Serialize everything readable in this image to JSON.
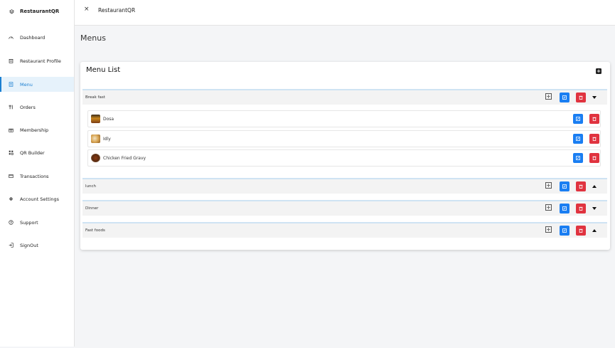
{
  "app": {
    "brand": "RestaurantQR",
    "top_title": "RestaurantQR",
    "close_glyph": "×"
  },
  "sidebar": {
    "items": [
      {
        "label": "Dashboard",
        "icon": "dashboard-icon"
      },
      {
        "label": "Restaurant Profile",
        "icon": "building-icon"
      },
      {
        "label": "Menu",
        "icon": "menu-icon",
        "active": true
      },
      {
        "label": "Orders",
        "icon": "utensils-icon"
      },
      {
        "label": "Membership",
        "icon": "membership-icon"
      },
      {
        "label": "QR Builder",
        "icon": "qr-icon"
      },
      {
        "label": "Transactions",
        "icon": "transactions-icon"
      },
      {
        "label": "Account Settings",
        "icon": "gear-icon"
      },
      {
        "label": "Support",
        "icon": "help-icon"
      },
      {
        "label": "SignOut",
        "icon": "signout-icon"
      }
    ]
  },
  "page": {
    "title": "Menus"
  },
  "card": {
    "title": "Menu List",
    "add_glyph": "+"
  },
  "categories": [
    {
      "name": "Break fast",
      "expanded": true,
      "plus_glyph": "+",
      "items": [
        {
          "name": "Dosa"
        },
        {
          "name": "Idly"
        },
        {
          "name": "Chicken Fried Gravy"
        }
      ]
    },
    {
      "name": "lunch",
      "expanded": false,
      "plus_glyph": "+",
      "items": []
    },
    {
      "name": "Dinner",
      "expanded": false,
      "plus_glyph": "+",
      "items": []
    },
    {
      "name": "Fast foods",
      "expanded": false,
      "plus_glyph": "+",
      "items": []
    }
  ],
  "colors": {
    "accent": "#1b7fd1",
    "edit": "#1a7ef2",
    "delete": "#e0333f",
    "background": "#f4f5f7"
  }
}
